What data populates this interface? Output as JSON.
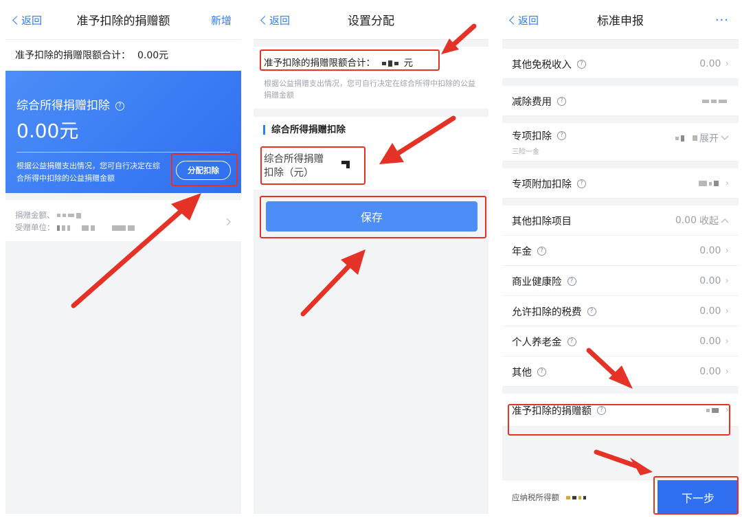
{
  "screen1": {
    "nav": {
      "back": "返回",
      "title": "准予扣除的捐赠额",
      "right": "新增"
    },
    "limit_label": "准予扣除的捐赠限额合计：",
    "limit_amount": "0.00元",
    "card": {
      "title": "综合所得捐赠扣除",
      "help": "?",
      "amount": "0.00元",
      "desc": "根据公益捐赠支出情况，您可自行决定在综合所得中扣除的公益捐赠金额",
      "button": "分配扣除"
    },
    "donation": {
      "amount_label": "捐赠金额、",
      "org_label": "受赠单位："
    }
  },
  "screen2": {
    "nav": {
      "back": "返回",
      "title": "设置分配"
    },
    "limit_label": "准予扣除的捐赠限额合计：",
    "limit_unit": "元",
    "desc": "根据公益捐赠支出情况，您可自行决定在综合所得中扣除的公益捐赠金额",
    "section_title": "综合所得捐赠扣除",
    "field_label": "综合所得捐赠扣除（元）",
    "save": "保存"
  },
  "screen3": {
    "nav": {
      "back": "返回",
      "title": "标准申报",
      "more": "···"
    },
    "rows": {
      "other_tax_free": {
        "label": "其他免税收入",
        "value": "0.00"
      },
      "deduction_fee": {
        "label": "减除费用"
      },
      "special": {
        "label": "专项扣除",
        "sub": "三险一金",
        "action": "展开"
      },
      "special_additional": {
        "label": "专项附加扣除"
      },
      "other_items": {
        "label": "其他扣除项目",
        "value": "0.00",
        "action": "收起"
      },
      "annuity": {
        "label": "年金",
        "value": "0.00"
      },
      "health": {
        "label": "商业健康险",
        "value": "0.00"
      },
      "tax_fee": {
        "label": "允许扣除的税费",
        "value": "0.00"
      },
      "pension": {
        "label": "个人养老金",
        "value": "0.00"
      },
      "other": {
        "label": "其他",
        "value": "0.00"
      },
      "donation": {
        "label": "准予扣除的捐赠额"
      }
    },
    "bottom_label": "应纳税所得额",
    "next": "下一步"
  },
  "colors": {
    "accent": "#2f7df6",
    "annotation": "#e53226",
    "card": "#3a7cf4"
  }
}
